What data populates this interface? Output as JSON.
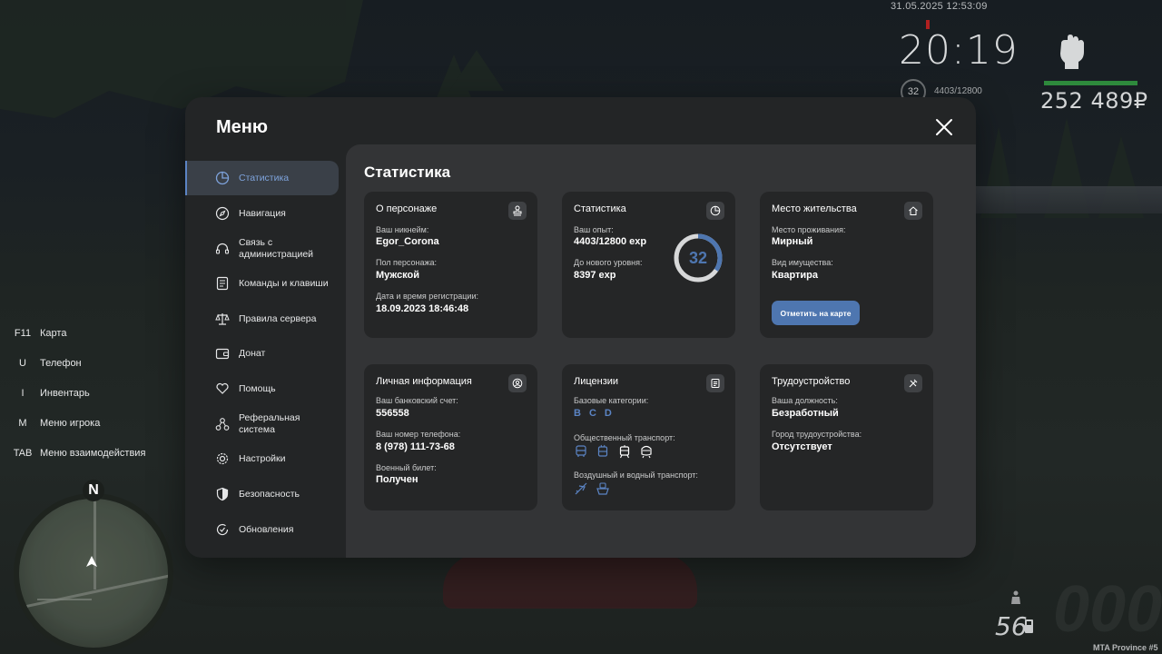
{
  "hud": {
    "datetime": "31.05.2025 12:53:09",
    "clock": "20:19",
    "level": "32",
    "exp": "4403/12800",
    "money": "252 489₽",
    "fuel": "56",
    "server": "MTA Province #5",
    "compass_north": "N",
    "colors": {
      "money_bar": "#2e8a3c",
      "clock_marker": "#b02020"
    }
  },
  "hotkeys": [
    {
      "key": "F11",
      "label": "Карта"
    },
    {
      "key": "U",
      "label": "Телефон"
    },
    {
      "key": "I",
      "label": "Инвентарь"
    },
    {
      "key": "M",
      "label": "Меню игрока"
    },
    {
      "key": "TAB",
      "label": "Меню взаимодействия"
    }
  ],
  "menu": {
    "title": "Меню",
    "accent": "#5b84c4",
    "sidebar": [
      {
        "label": "Статистика",
        "icon": "pie-chart-icon",
        "active": true
      },
      {
        "label": "Навигация",
        "icon": "compass-icon"
      },
      {
        "label": "Связь с администрацией",
        "icon": "headset-icon"
      },
      {
        "label": "Команды и клавиши",
        "icon": "document-icon"
      },
      {
        "label": "Правила сервера",
        "icon": "scales-icon"
      },
      {
        "label": "Донат",
        "icon": "wallet-icon"
      },
      {
        "label": "Помощь",
        "icon": "heart-hands-icon"
      },
      {
        "label": "Реферальная система",
        "icon": "network-icon"
      },
      {
        "label": "Настройки",
        "icon": "gear-icon"
      },
      {
        "label": "Безопасность",
        "icon": "shield-icon"
      },
      {
        "label": "Обновления",
        "icon": "refresh-check-icon"
      }
    ]
  },
  "stats": {
    "title": "Статистика",
    "character": {
      "title": "О персонаже",
      "nickname_label": "Ваш никнейм:",
      "nickname": "Egor_Corona",
      "gender_label": "Пол персонажа:",
      "gender": "Мужской",
      "reg_label": "Дата и время регистрации:",
      "reg": "18.09.2023 18:46:48"
    },
    "statistics": {
      "title": "Статистика",
      "exp_label": "Ваш опыт:",
      "exp": "4403/12800 exp",
      "next_label": "До нового уровня:",
      "next": "8397 exp",
      "level": "32",
      "progress": 0.344
    },
    "residence": {
      "title": "Место жительства",
      "place_label": "Место проживания:",
      "place": "Мирный",
      "type_label": "Вид имущества:",
      "type": "Квартира",
      "button": "Отметить на карте"
    },
    "personal": {
      "title": "Личная информация",
      "bank_label": "Ваш банковский счет:",
      "bank": "556558",
      "phone_label": "Ваш номер телефона:",
      "phone": "8 (978) 111-73-68",
      "military_label": "Военный билет:",
      "military": "Получен"
    },
    "licenses": {
      "title": "Лицензии",
      "base_label": "Базовые категории:",
      "categories": [
        "B",
        "C",
        "D"
      ],
      "public_label": "Общественный транспорт:",
      "public_icons": [
        "bus-icon",
        "trolleybus-icon",
        "tram-icon",
        "train-icon"
      ],
      "air_label": "Воздушный и водный транспорт:",
      "air_icons": [
        "plane-icon",
        "boat-icon"
      ]
    },
    "employment": {
      "title": "Трудоустройство",
      "position_label": "Ваша должность:",
      "position": "Безработный",
      "city_label": "Город трудоустройства:",
      "city": "Отсутствует"
    }
  }
}
